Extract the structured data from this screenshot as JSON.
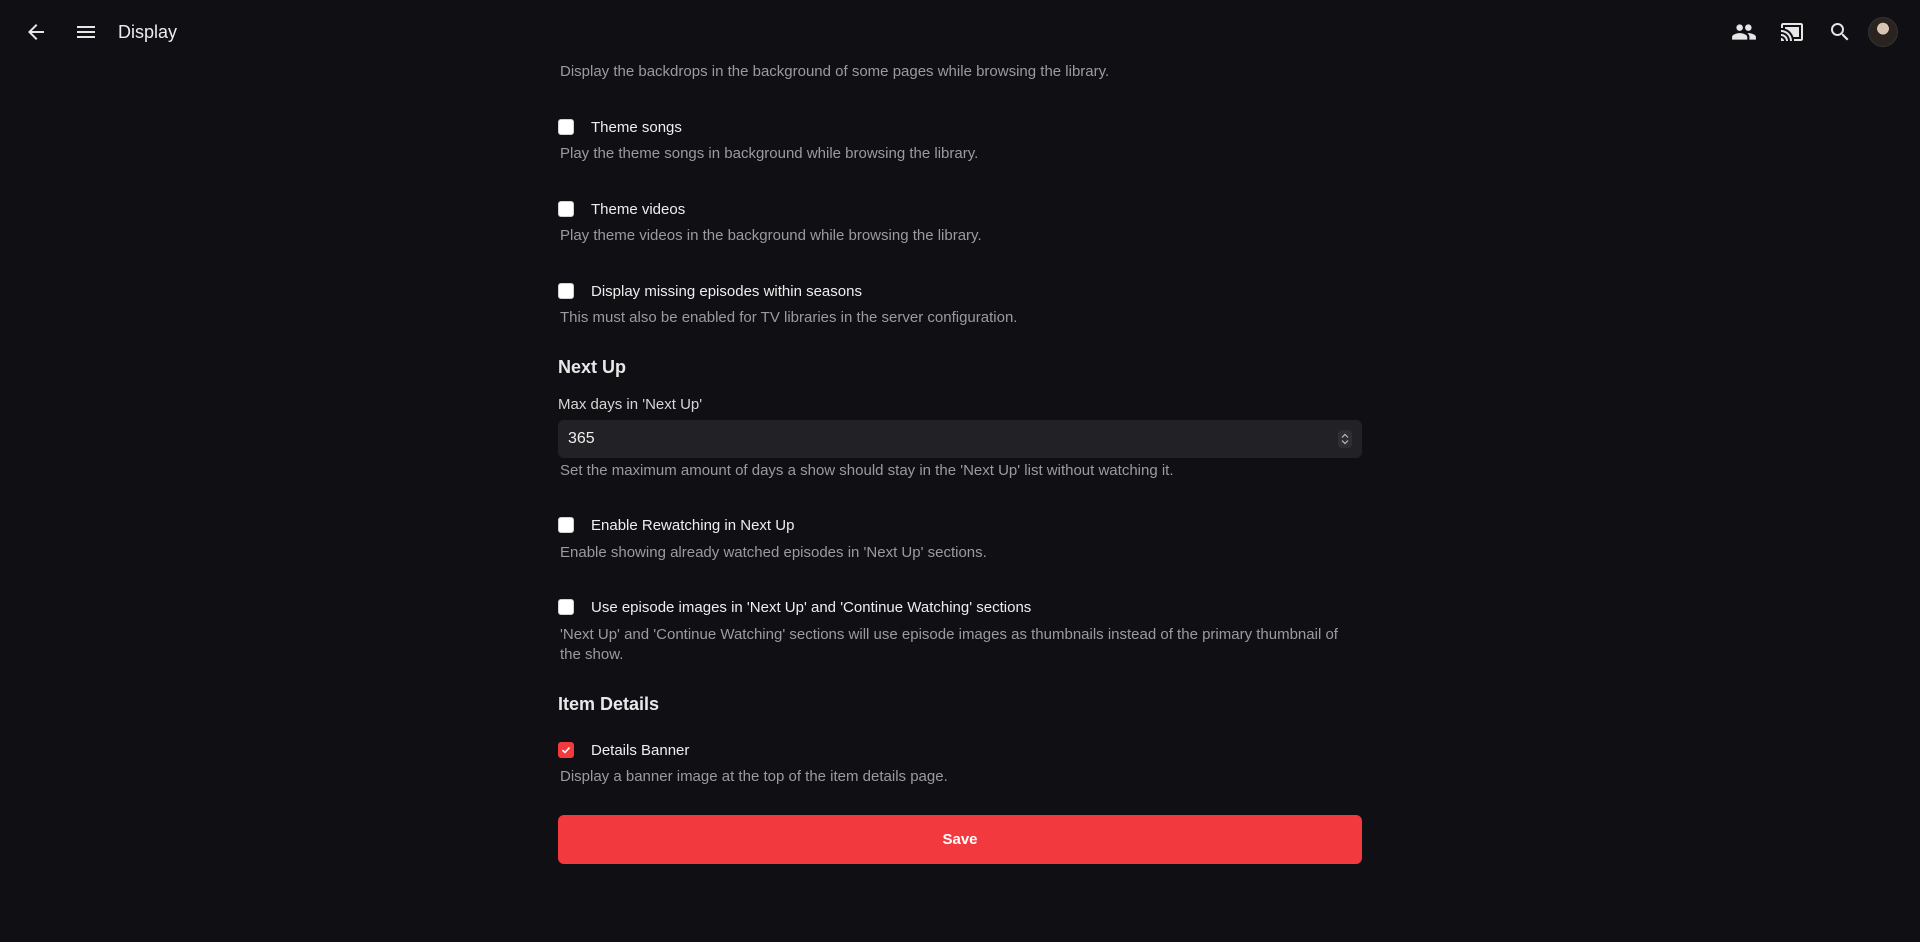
{
  "header": {
    "title": "Display",
    "icons": [
      "back-arrow-icon",
      "menu-icon",
      "users-icon",
      "cast-icon",
      "search-icon",
      "avatar"
    ]
  },
  "settings": {
    "backdrops_desc": "Display the backdrops in the background of some pages while browsing the library.",
    "theme_songs": {
      "label": "Theme songs",
      "desc": "Play the theme songs in background while browsing the library.",
      "checked": false
    },
    "theme_videos": {
      "label": "Theme videos",
      "desc": "Play theme videos in the background while browsing the library.",
      "checked": false
    },
    "missing_episodes": {
      "label": "Display missing episodes within seasons",
      "desc": "This must also be enabled for TV libraries in the server configuration.",
      "checked": false
    }
  },
  "next_up": {
    "heading": "Next Up",
    "max_days_label": "Max days in 'Next Up'",
    "max_days_value": "365",
    "max_days_desc": "Set the maximum amount of days a show should stay in the 'Next Up' list without watching it.",
    "rewatching": {
      "label": "Enable Rewatching in Next Up",
      "desc": "Enable showing already watched episodes in 'Next Up' sections.",
      "checked": false
    },
    "episode_images": {
      "label": "Use episode images in 'Next Up' and 'Continue Watching' sections",
      "desc": "'Next Up' and 'Continue Watching' sections will use episode images as thumbnails instead of the primary thumbnail of the show.",
      "checked": false
    }
  },
  "item_details": {
    "heading": "Item Details",
    "details_banner": {
      "label": "Details Banner",
      "desc": "Display a banner image at the top of the item details page.",
      "checked": true
    }
  },
  "save_label": "Save",
  "colors": {
    "accent": "#f23a3e",
    "background": "#101014",
    "input_bg": "#222226"
  }
}
